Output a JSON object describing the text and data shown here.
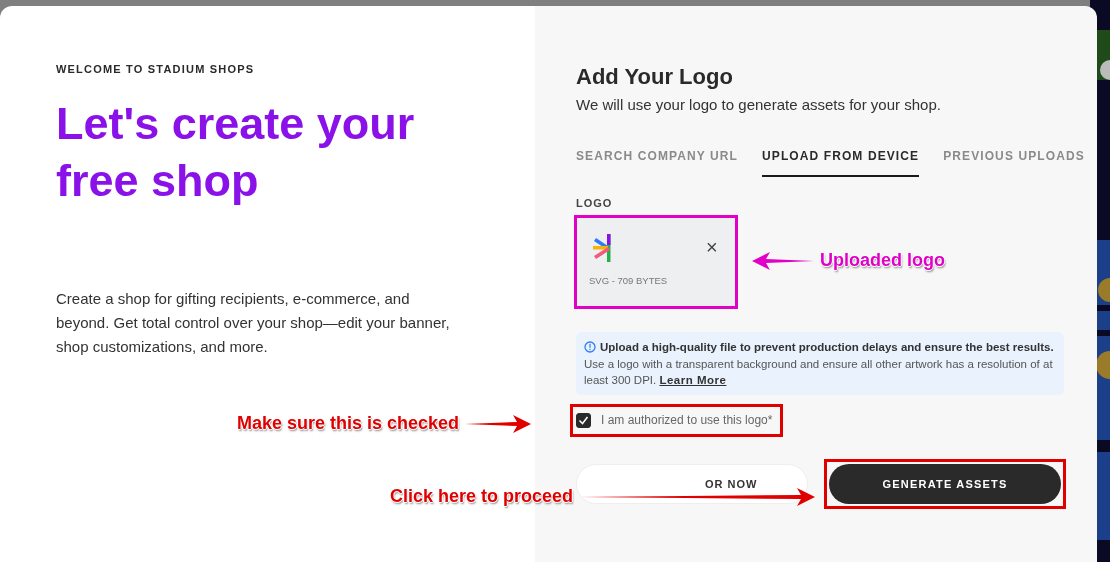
{
  "intro": {
    "eyebrow": "WELCOME TO STADIUM SHOPS",
    "heading": "Let's create your free shop",
    "description": "Create a shop for gifting recipients, e-commerce, and beyond. Get total control over your shop—edit your banner, shop customizations, and more."
  },
  "logo_panel": {
    "title": "Add Your Logo",
    "subtitle": "We will use your logo to generate assets for your shop.",
    "tabs": [
      {
        "label": "SEARCH COMPANY URL",
        "selected": false
      },
      {
        "label": "UPLOAD FROM DEVICE",
        "selected": true
      },
      {
        "label": "PREVIOUS UPLOADS",
        "selected": false
      }
    ],
    "logo_label": "LOGO",
    "upload": {
      "file_info": "SVG - 709 BYTES",
      "remove": "×"
    },
    "notice": {
      "text": "**Upload a high-quality file to prevent production delays and ensure the best results.** Use a logo with a transparent background and ensure all other artwork has a resolution of at least 300 DPI.",
      "link": "Learn More"
    },
    "authorization": {
      "label": "I am authorized to use this logo*",
      "checked": true
    },
    "buttons": [
      {
        "kind": "secondary",
        "label": "OR NOW"
      },
      {
        "kind": "primary",
        "label": "GENERATE ASSETS"
      }
    ]
  },
  "annotations": [
    {
      "kind": "left-arrow",
      "text": "Uploaded logo",
      "color": "#e100c8"
    },
    {
      "kind": "right-arrow",
      "text": "Make sure this is checked",
      "color": "#e00000"
    },
    {
      "kind": "right-arrow",
      "text": "Click here to proceed",
      "color": "#e00000"
    }
  ]
}
